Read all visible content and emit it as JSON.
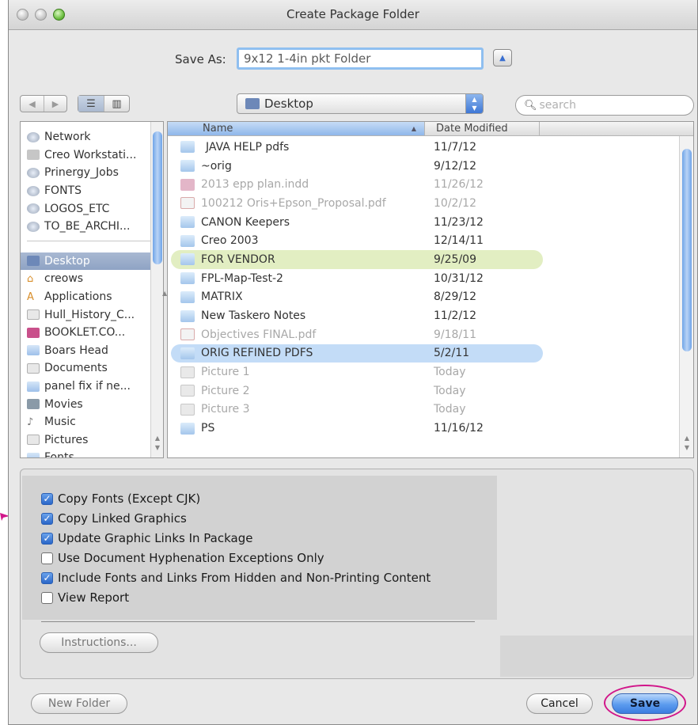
{
  "window": {
    "title": "Create Package Folder"
  },
  "save_as": {
    "label": "Save As:",
    "value": "9x12 1-4in pkt Folder"
  },
  "location": {
    "current": "Desktop"
  },
  "search": {
    "placeholder": "search",
    "icon": "magnifier-icon"
  },
  "sidebar": {
    "devices": [
      {
        "label": "Network",
        "icon": "network-icon"
      },
      {
        "label": "Creo Workstati...",
        "icon": "computer-icon"
      },
      {
        "label": "Prinergy_Jobs",
        "icon": "network-share-icon"
      },
      {
        "label": "FONTS",
        "icon": "network-share-icon"
      },
      {
        "label": "LOGOS_ETC",
        "icon": "network-share-icon"
      },
      {
        "label": "TO_BE_ARCHI...",
        "icon": "network-share-icon"
      }
    ],
    "places": [
      {
        "label": "Desktop",
        "icon": "desktop-icon",
        "selected": true
      },
      {
        "label": "creows",
        "icon": "home-icon"
      },
      {
        "label": "Applications",
        "icon": "applications-icon"
      },
      {
        "label": "Hull_History_C...",
        "icon": "document-icon"
      },
      {
        "label": "BOOKLET.CO...",
        "icon": "indesign-file-icon"
      },
      {
        "label": "Boars Head",
        "icon": "folder-icon"
      },
      {
        "label": "Documents",
        "icon": "documents-icon"
      },
      {
        "label": "panel fix if ne...",
        "icon": "folder-icon"
      },
      {
        "label": "Movies",
        "icon": "movies-icon"
      },
      {
        "label": "Music",
        "icon": "music-icon"
      },
      {
        "label": "Pictures",
        "icon": "pictures-icon"
      },
      {
        "label": "Fonts",
        "icon": "folder-icon"
      }
    ]
  },
  "file_list": {
    "columns": {
      "name": "Name",
      "date": "Date Modified"
    },
    "rows": [
      {
        "name": "JAVA HELP pdfs",
        "date": "11/7/12",
        "kind": "folder"
      },
      {
        "name": "~orig",
        "date": "9/12/12",
        "kind": "folder"
      },
      {
        "name": "2013 epp plan.indd",
        "date": "11/26/12",
        "kind": "indd",
        "dimmed": true
      },
      {
        "name": "100212 Oris+Epson_Proposal.pdf",
        "date": "10/2/12",
        "kind": "pdf",
        "dimmed": true
      },
      {
        "name": "CANON Keepers",
        "date": "11/23/12",
        "kind": "folder"
      },
      {
        "name": "Creo 2003",
        "date": "12/14/11",
        "kind": "folder"
      },
      {
        "name": "FOR VENDOR",
        "date": "9/25/09",
        "kind": "folder",
        "highlight": "green"
      },
      {
        "name": "FPL-Map-Test-2",
        "date": "10/31/12",
        "kind": "folder"
      },
      {
        "name": "MATRIX",
        "date": "8/29/12",
        "kind": "folder"
      },
      {
        "name": "New Taskero Notes",
        "date": "11/2/12",
        "kind": "folder"
      },
      {
        "name": "Objectives FINAL.pdf",
        "date": "9/18/11",
        "kind": "pdf",
        "dimmed": true
      },
      {
        "name": "ORIG REFINED PDFS",
        "date": "5/2/11",
        "kind": "folder",
        "highlight": "blue"
      },
      {
        "name": "Picture 1",
        "date": "Today",
        "kind": "picture",
        "dimmed": true
      },
      {
        "name": "Picture 2",
        "date": "Today",
        "kind": "picture",
        "dimmed": true
      },
      {
        "name": "Picture 3",
        "date": "Today",
        "kind": "picture",
        "dimmed": true
      },
      {
        "name": "PS",
        "date": "11/16/12",
        "kind": "folder"
      }
    ]
  },
  "options": [
    {
      "label": "Copy Fonts (Except CJK)",
      "checked": true
    },
    {
      "label": "Copy Linked Graphics",
      "checked": true
    },
    {
      "label": "Update Graphic Links In Package",
      "checked": true
    },
    {
      "label": "Use Document Hyphenation Exceptions Only",
      "checked": false
    },
    {
      "label": "Include Fonts and Links From Hidden and Non-Printing Content",
      "checked": true
    },
    {
      "label": "View Report",
      "checked": false
    }
  ],
  "buttons": {
    "instructions": "Instructions...",
    "new_folder": "New Folder",
    "cancel": "Cancel",
    "save": "Save"
  },
  "colors": {
    "annotation": "#d1168a",
    "selection_blue": "#c3dcf7",
    "label_green": "#e2eec2"
  }
}
